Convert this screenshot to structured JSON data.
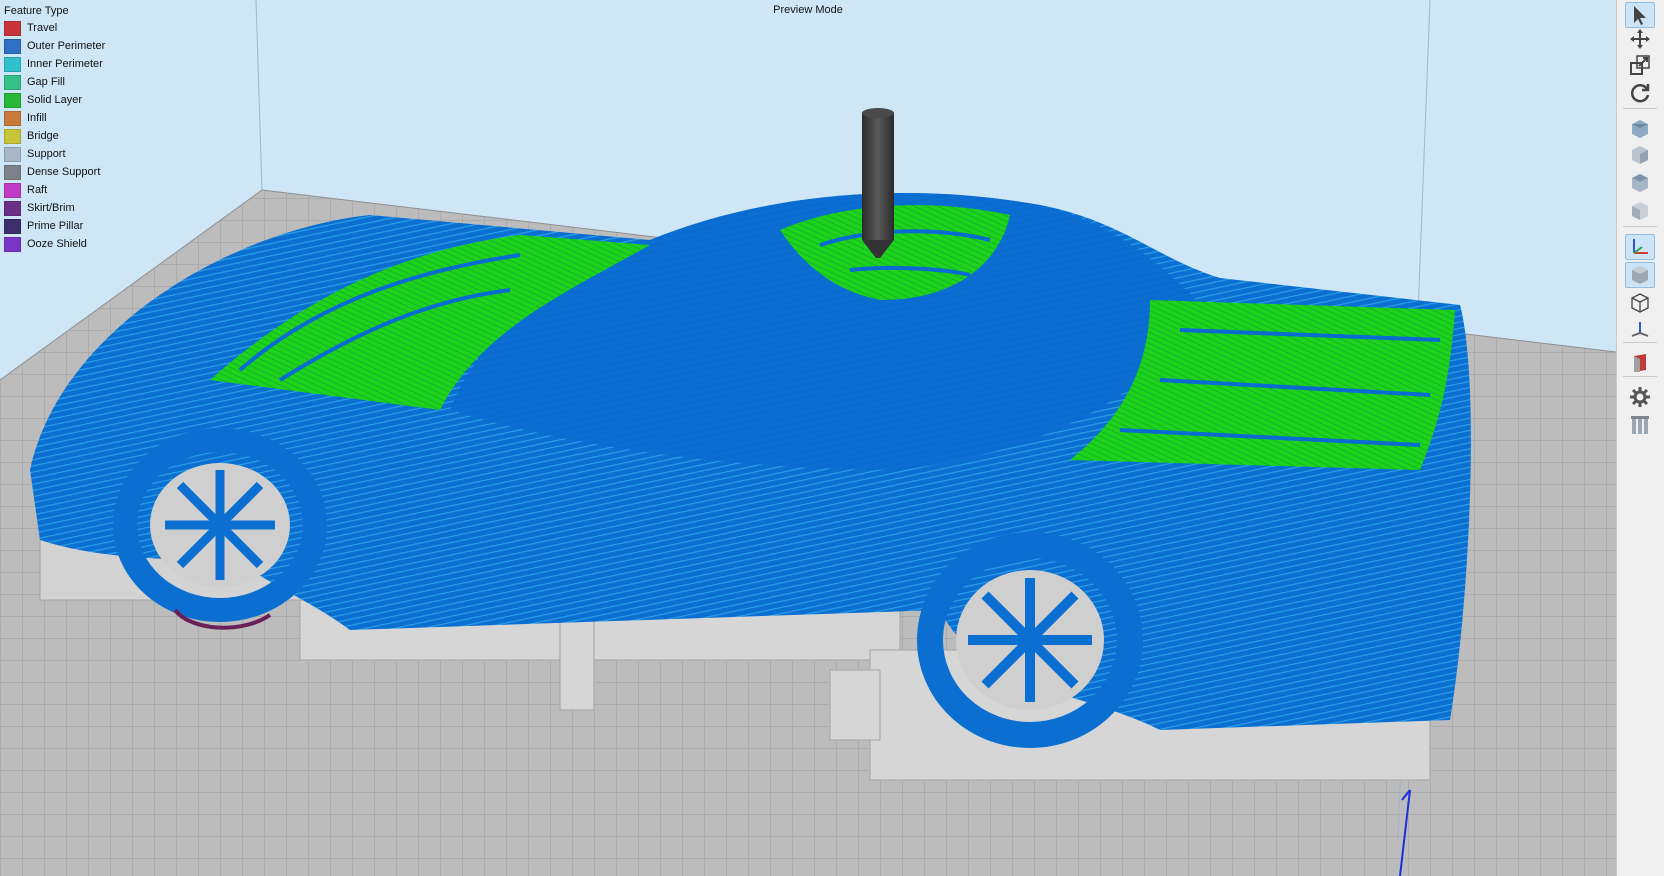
{
  "view": {
    "mode_title": "Preview Mode",
    "background_color": "#cfe6f7",
    "bed_color": "#b9b9b9"
  },
  "legend": {
    "title": "Feature Type",
    "items": [
      {
        "label": "Travel",
        "color": "#c8343a"
      },
      {
        "label": "Outer Perimeter",
        "color": "#2f6fc4"
      },
      {
        "label": "Inner Perimeter",
        "color": "#2fc0cc"
      },
      {
        "label": "Gap Fill",
        "color": "#35c08a"
      },
      {
        "label": "Solid Layer",
        "color": "#27b83a"
      },
      {
        "label": "Infill",
        "color": "#c97a3a"
      },
      {
        "label": "Bridge",
        "color": "#c7c43a"
      },
      {
        "label": "Support",
        "color": "#a9b7c6"
      },
      {
        "label": "Dense Support",
        "color": "#7c8287"
      },
      {
        "label": "Raft",
        "color": "#c03ac8"
      },
      {
        "label": "Skirt/Brim",
        "color": "#6b2f86"
      },
      {
        "label": "Prime Pillar",
        "color": "#3c2f6b"
      },
      {
        "label": "Ooze Shield",
        "color": "#7a35c8"
      }
    ]
  },
  "toolbar": {
    "tools": [
      {
        "name": "select-tool",
        "icon": "arrow-cursor-icon",
        "active": true
      },
      {
        "name": "move-tool",
        "icon": "move-arrows-icon",
        "active": false
      },
      {
        "name": "scale-tool",
        "icon": "scale-icon",
        "active": false
      },
      {
        "name": "rotate-tool",
        "icon": "rotate-icon",
        "active": false
      },
      {
        "name": "view-iso-button",
        "icon": "cube-icon",
        "active": false
      },
      {
        "name": "view-front-button",
        "icon": "cube-front-icon",
        "active": false
      },
      {
        "name": "view-top-button",
        "icon": "cube-top-icon",
        "active": false
      },
      {
        "name": "view-side-button",
        "icon": "cube-side-icon",
        "active": false
      },
      {
        "name": "show-axes-toggle",
        "icon": "axes-icon",
        "active": true
      },
      {
        "name": "solid-view-toggle",
        "icon": "solid-cube-icon",
        "active": true
      },
      {
        "name": "wireframe-view-toggle",
        "icon": "wireframe-cube-icon",
        "active": false
      },
      {
        "name": "section-view-toggle",
        "icon": "section-axis-icon",
        "active": false
      },
      {
        "name": "cross-section-toggle",
        "icon": "cross-section-icon",
        "active": false
      },
      {
        "name": "settings-button",
        "icon": "gear-icon",
        "active": false
      },
      {
        "name": "supports-button",
        "icon": "support-pillars-icon",
        "active": false
      }
    ]
  }
}
